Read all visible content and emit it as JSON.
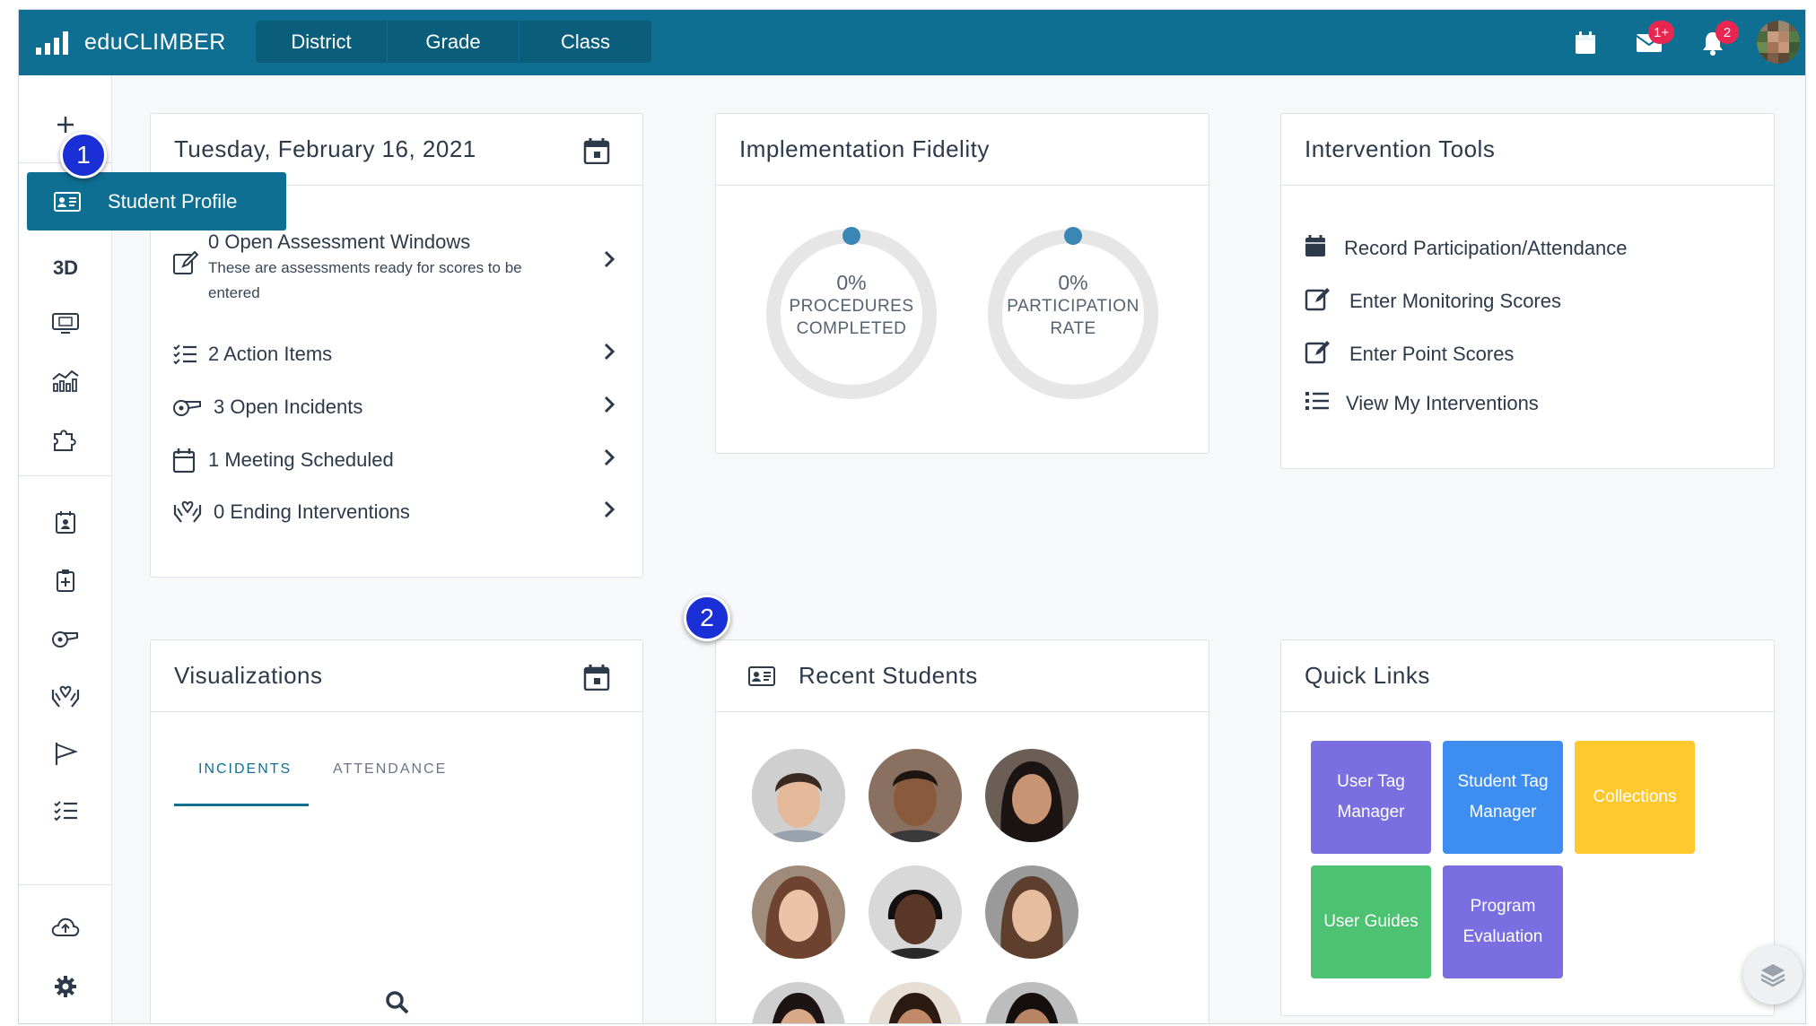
{
  "app": {
    "name": "eduCLIMBER"
  },
  "scope_tabs": [
    "District",
    "Grade",
    "Class"
  ],
  "header": {
    "mail_badge": "1+",
    "notification_badge": "2"
  },
  "sidebar": {
    "label_3d": "3D",
    "flyout_label": "Student Profile"
  },
  "steps": [
    "1",
    "2"
  ],
  "alerts": {
    "date": "Tuesday, February 16, 2021",
    "items": [
      {
        "label": "0 Open Assessment Windows",
        "sub": "These are assessments ready for scores to be entered"
      },
      {
        "label": "2 Action Items"
      },
      {
        "label": "3 Open Incidents"
      },
      {
        "label": "1 Meeting Scheduled"
      },
      {
        "label": "0 Ending Interventions"
      }
    ]
  },
  "fidelity": {
    "title": "Implementation Fidelity",
    "donuts": [
      {
        "pct": "0%",
        "line1": "PROCEDURES",
        "line2": "COMPLETED",
        "value": 0
      },
      {
        "pct": "0%",
        "line1": "PARTICIPATION",
        "line2": "RATE",
        "value": 0
      }
    ]
  },
  "tools": {
    "title": "Intervention Tools",
    "items": [
      "Record Participation/Attendance",
      "Enter Monitoring Scores",
      "Enter Point Scores",
      "View My Interventions"
    ]
  },
  "viz": {
    "title": "Visualizations",
    "tabs": [
      "INCIDENTS",
      "ATTENDANCE"
    ],
    "active_tab": "INCIDENTS"
  },
  "recent": {
    "title": "Recent Students"
  },
  "quick_links": {
    "title": "Quick Links",
    "items": [
      {
        "line1": "User Tag",
        "line2": "Manager",
        "color": "#7b6ee0"
      },
      {
        "line1": "Student Tag",
        "line2": "Manager",
        "color": "#3d8ef0"
      },
      {
        "line1": "Collections",
        "line2": "",
        "color": "#ffc82c"
      },
      {
        "line1": "User Guides",
        "line2": "",
        "color": "#4cc272"
      },
      {
        "line1": "Program",
        "line2": "Evaluation",
        "color": "#7b6ee0"
      }
    ]
  },
  "colors": {
    "brand": "#0f6f93",
    "badge": "#e8264f",
    "step": "#1a2fd6"
  }
}
